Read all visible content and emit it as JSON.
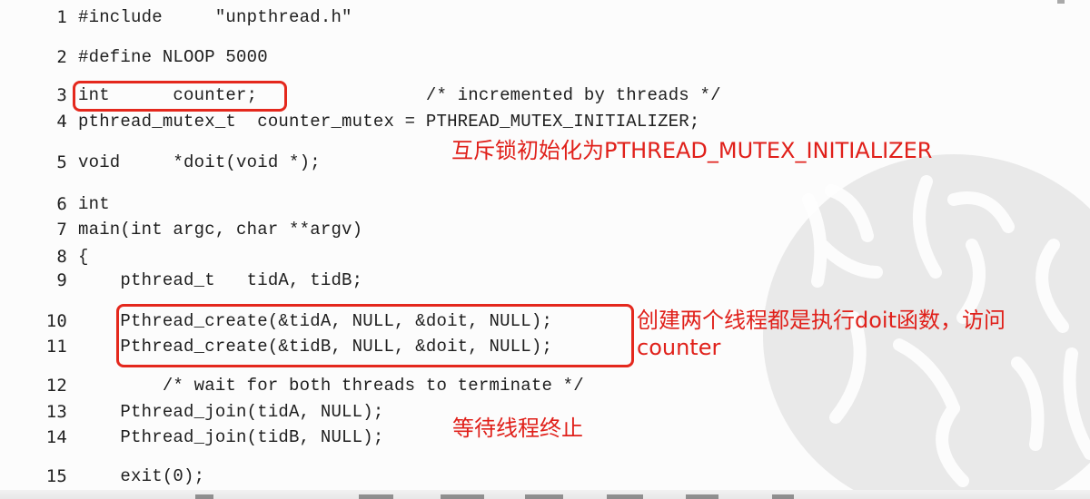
{
  "code_lines": [
    {
      "num": "1",
      "text": "#include     \"unpthread.h\""
    },
    {
      "num": "2",
      "text": "#define NLOOP 5000"
    },
    {
      "num": "3",
      "text": "int      counter;                /* incremented by threads */"
    },
    {
      "num": "4",
      "text": "pthread_mutex_t  counter_mutex = PTHREAD_MUTEX_INITIALIZER;"
    },
    {
      "num": "5",
      "text": "void     *doit(void *);"
    },
    {
      "num": "6",
      "text": "int"
    },
    {
      "num": "7",
      "text": "main(int argc, char **argv)"
    },
    {
      "num": "8",
      "text": "{"
    },
    {
      "num": "9",
      "text": "    pthread_t   tidA, tidB;"
    },
    {
      "num": "10",
      "text": "    Pthread_create(&tidA, NULL, &doit, NULL);"
    },
    {
      "num": "11",
      "text": "    Pthread_create(&tidB, NULL, &doit, NULL);"
    },
    {
      "num": "12",
      "text": "        /* wait for both threads to terminate */"
    },
    {
      "num": "13",
      "text": "    Pthread_join(tidA, NULL);"
    },
    {
      "num": "14",
      "text": "    Pthread_join(tidB, NULL);"
    },
    {
      "num": "15",
      "text": "    exit(0);"
    }
  ],
  "annotations": {
    "mutex_init": "互斥锁初始化为PTHREAD_MUTEX_INITIALIZER",
    "create_threads_line1": "创建两个线程都是执行doit函数，访问",
    "create_threads_line2": "counter",
    "wait_threads": "等待线程终止"
  },
  "colors": {
    "annotation": "#e0201a",
    "highlight_box": "#e4281d",
    "code_text": "#1e1e1e"
  }
}
